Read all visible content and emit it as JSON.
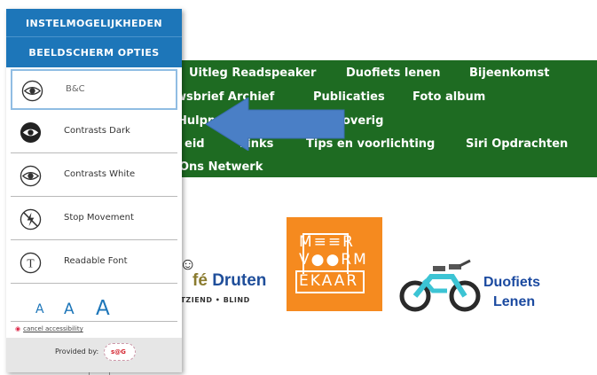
{
  "nav": {
    "items": [
      "Uitleg Readspeaker",
      "Duofiets lenen",
      "Bijeenkomst",
      "wsbrief Archief",
      "Publicaties",
      "Foto album",
      "Hulpmi",
      "overig",
      "eid",
      "Links",
      "Tips en voorlichting",
      "Siri Opdrachten",
      "Ons Netwerk"
    ]
  },
  "panel": {
    "title": "INSTELMOGELIJKHEDEN",
    "subtitle": "BEELDSCHERM OPTIES",
    "options": [
      {
        "label": "B&C",
        "icon": "eye-outline-icon",
        "selected": true
      },
      {
        "label": "Contrasts Dark",
        "icon": "eye-dark-icon",
        "selected": false
      },
      {
        "label": "Contrasts White",
        "icon": "eye-white-icon",
        "selected": false
      },
      {
        "label": "Stop Movement",
        "icon": "stop-movement-icon",
        "selected": false
      },
      {
        "label": "Readable Font",
        "icon": "readable-font-icon",
        "selected": false
      }
    ],
    "font_sizes": [
      "A",
      "A",
      "A"
    ],
    "cancel": "cancel accessibility",
    "provided_by": "Provided by:",
    "provider_badge": "s@G"
  },
  "logos": {
    "druten_mark": "☺",
    "druten_cafe": "fé",
    "druten_name": "Druten",
    "druten_sub": "ITZIEND • BLIND",
    "meer_lines": [
      "M≡≡R",
      "V●●RM",
      "EKAAR"
    ],
    "duo_line1": "Duofiets",
    "duo_line2": "Lenen"
  },
  "colors": {
    "nav_green": "#1e6b22",
    "panel_blue": "#1d76b9",
    "arrow_blue": "#4a7fc6",
    "meer_orange": "#f58a1f"
  }
}
